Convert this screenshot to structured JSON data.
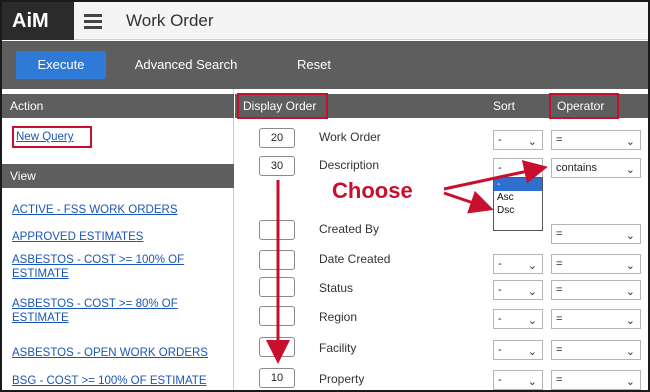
{
  "header": {
    "logo": "AiM",
    "title": "Work Order"
  },
  "toolbar": {
    "execute_label": "Execute",
    "advanced_label": "Advanced Search",
    "reset_label": "Reset"
  },
  "left_panel": {
    "action_title": "Action",
    "new_query": "New Query",
    "view_title": "View",
    "views": [
      "ACTIVE - FSS WORK ORDERS",
      "APPROVED ESTIMATES",
      "ASBESTOS - COST >= 100% OF ESTIMATE",
      "ASBESTOS - COST >= 80% OF ESTIMATE",
      "ASBESTOS - OPEN WORK ORDERS",
      "BSG - COST >= 100% OF ESTIMATE"
    ]
  },
  "grid": {
    "col_display_order": "Display Order",
    "col_sort": "Sort",
    "col_operator": "Operator",
    "rows": [
      {
        "order": "20",
        "label": "Work Order",
        "sort": "-",
        "operator": "="
      },
      {
        "order": "30",
        "label": "Description",
        "sort": "-",
        "operator": "contains"
      },
      {
        "order": "",
        "label": "Created By",
        "sort": "-",
        "operator": "="
      },
      {
        "order": "",
        "label": "Date Created",
        "sort": "-",
        "operator": "="
      },
      {
        "order": "",
        "label": "Status",
        "sort": "-",
        "operator": "="
      },
      {
        "order": "",
        "label": "Region",
        "sort": "-",
        "operator": "="
      },
      {
        "order": "",
        "label": "Facility",
        "sort": "-",
        "operator": "="
      },
      {
        "order": "10",
        "label": "Property",
        "sort": "-",
        "operator": "="
      }
    ],
    "sort_options": [
      "-",
      "Asc",
      "Dsc"
    ]
  },
  "annotation": {
    "text": "Choose",
    "color": "#c8102e"
  },
  "colors": {
    "accent_blue": "#2f7ad6",
    "toolbar_gray": "#5e5e5e",
    "link_blue": "#1a56b8"
  }
}
